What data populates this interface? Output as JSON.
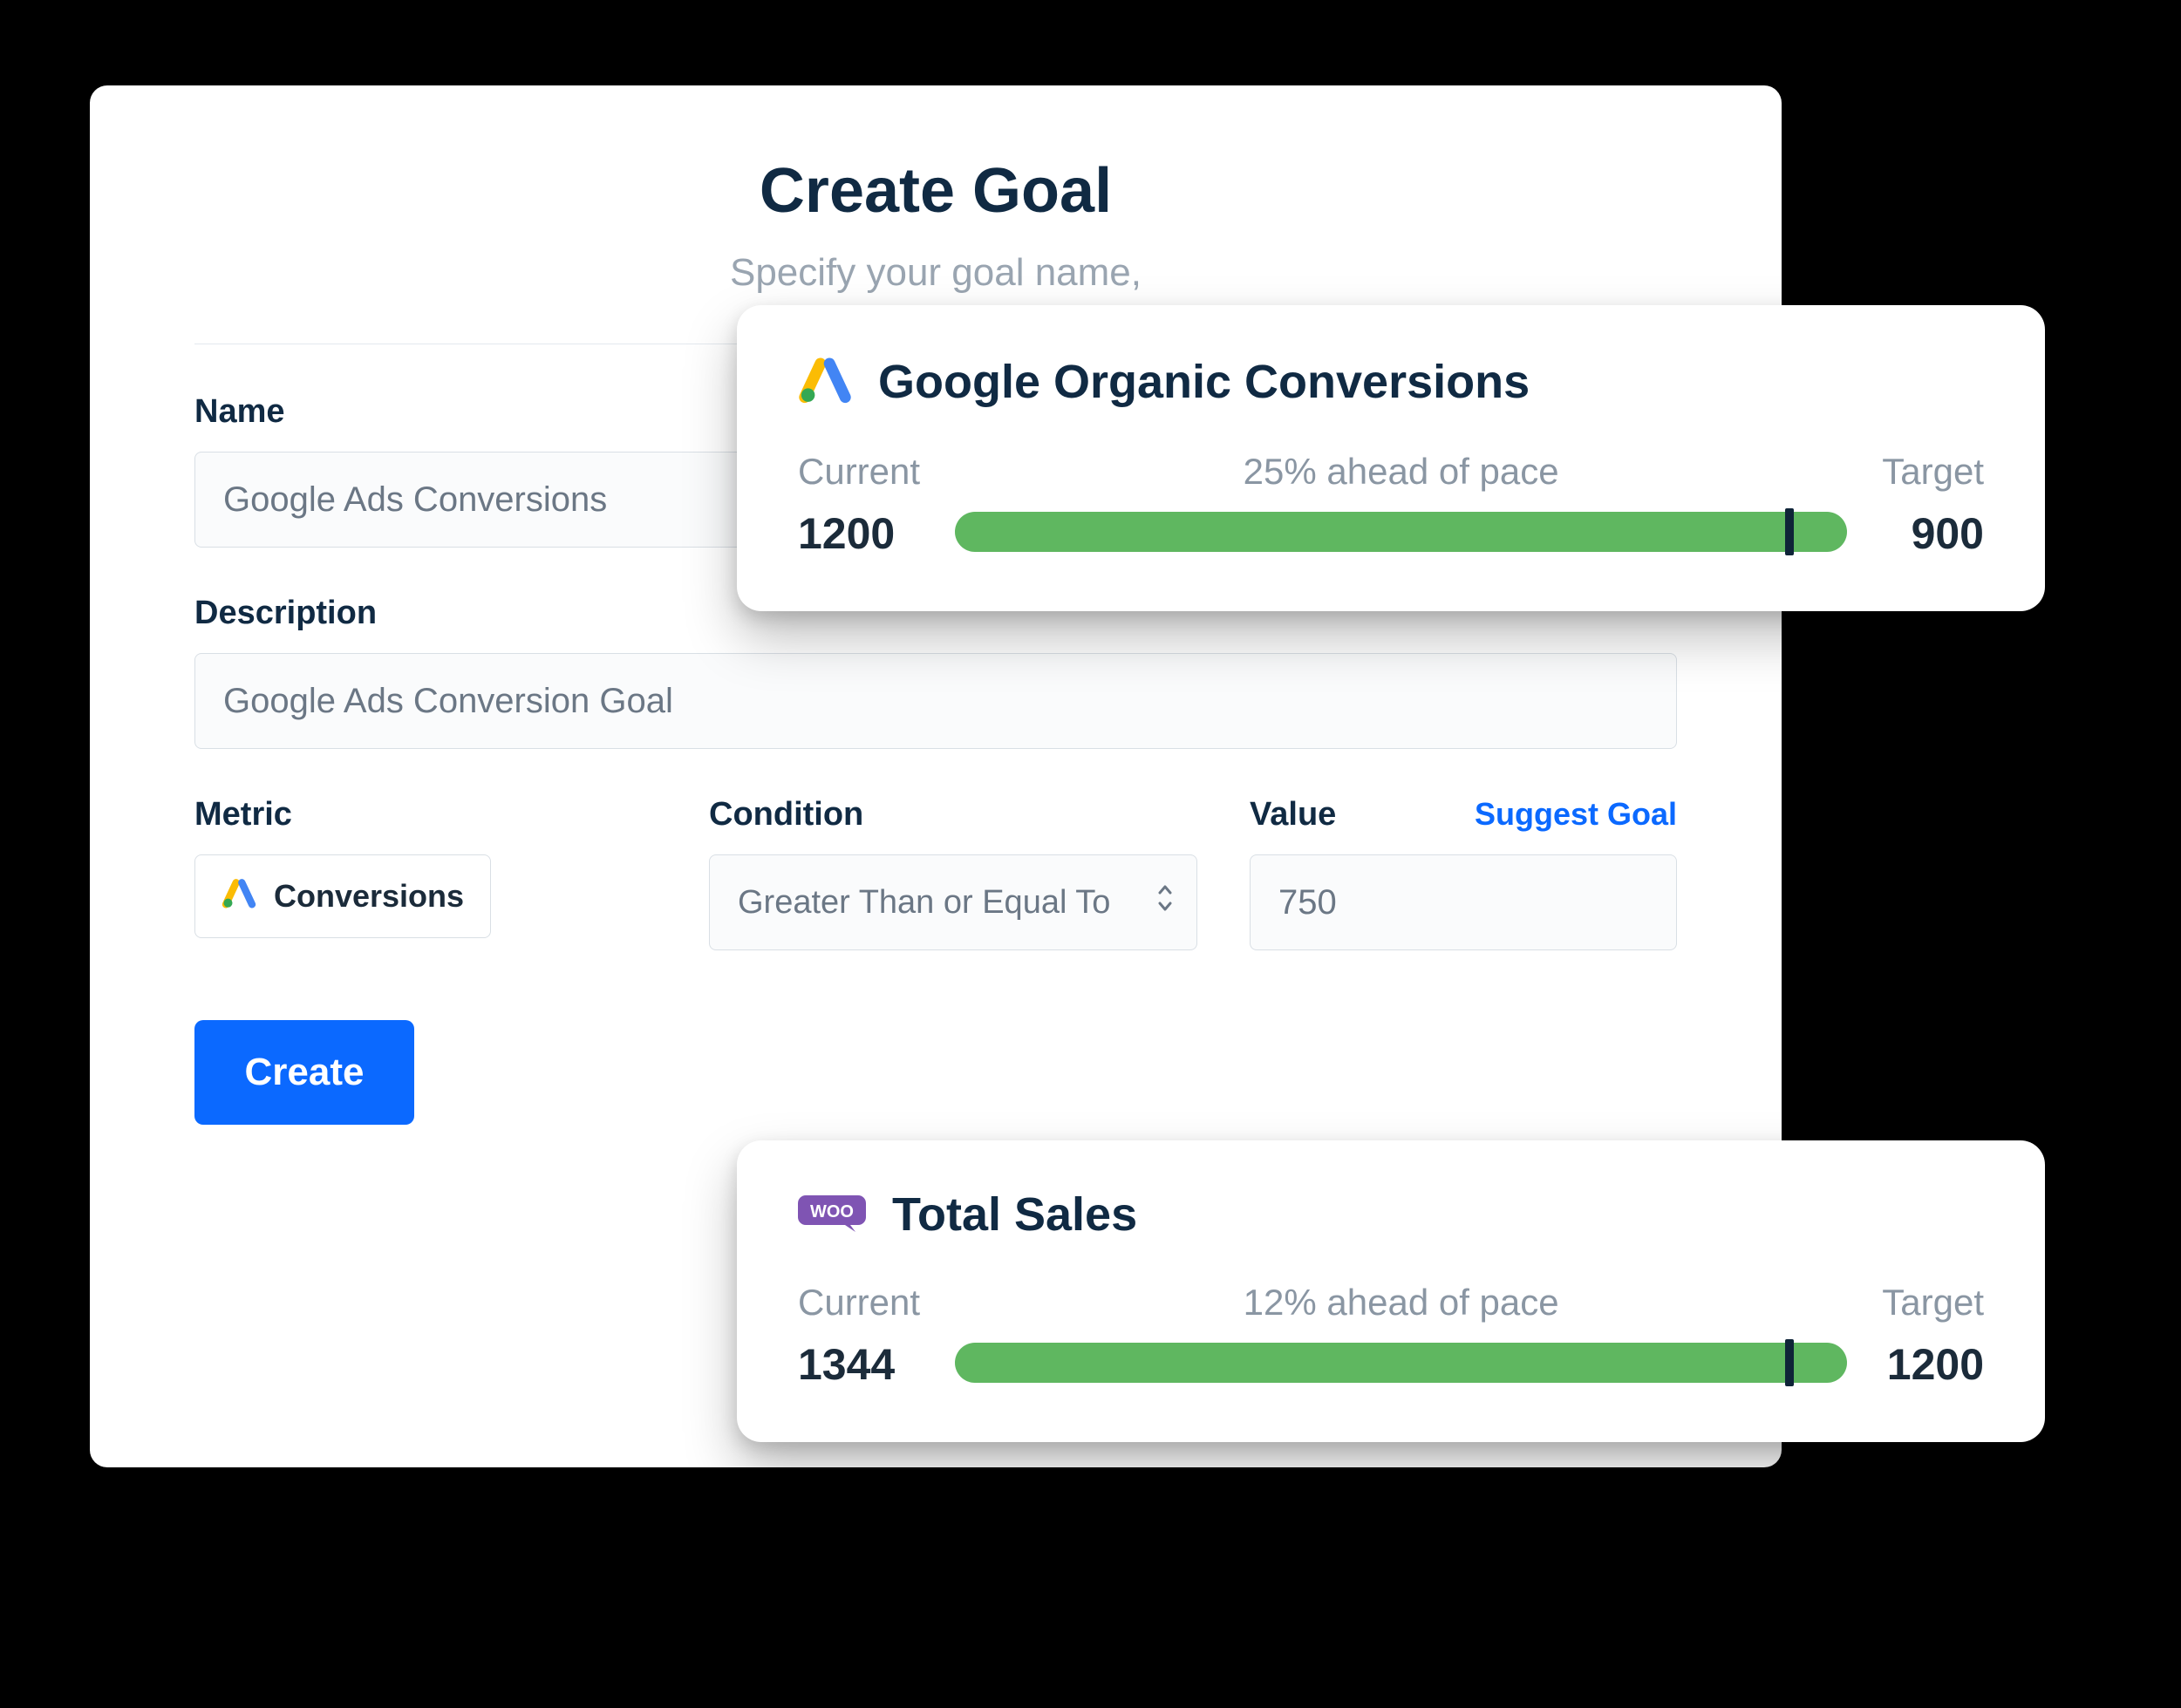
{
  "form": {
    "title": "Create Goal",
    "subtitle": "Specify your goal name,",
    "labels": {
      "name": "Name",
      "description": "Description",
      "metric": "Metric",
      "condition": "Condition",
      "value": "Value"
    },
    "suggest": "Suggest Goal",
    "values": {
      "name": "Google Ads Conversions",
      "description": "Google Ads Conversion Goal",
      "metric": "Conversions",
      "condition": "Greater Than or Equal To",
      "value": "750"
    },
    "create_label": "Create"
  },
  "goals": [
    {
      "icon": "google-ads",
      "title": "Google Organic Conversions",
      "current_label": "Current",
      "target_label": "Target",
      "pace_label": "25% ahead of pace",
      "current": "1200",
      "target": "900",
      "marker_pct": 93
    },
    {
      "icon": "woo",
      "title": "Total Sales",
      "current_label": "Current",
      "target_label": "Target",
      "pace_label": "12% ahead of pace",
      "current": "1344",
      "target": "1200",
      "marker_pct": 93
    }
  ],
  "colors": {
    "primary": "#0b69ff",
    "progress": "#5fb760",
    "marker": "#0f2438"
  }
}
